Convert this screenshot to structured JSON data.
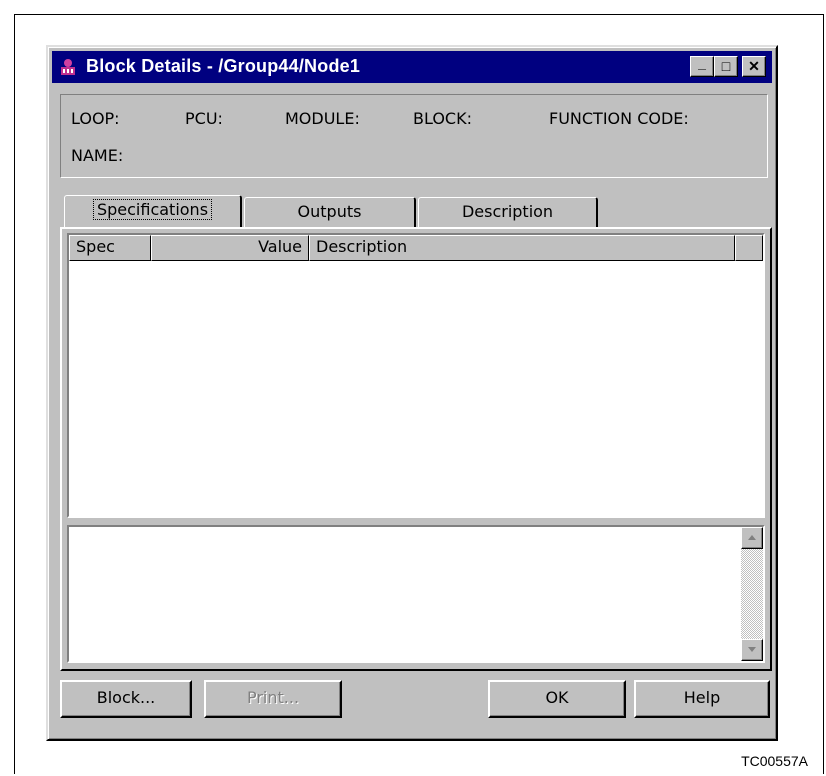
{
  "window": {
    "title": "Block Details - /Group44/Node1",
    "controls": {
      "minimize": "_",
      "maximize": "□",
      "close": "✕"
    }
  },
  "info": {
    "loop_label": "LOOP:",
    "pcu_label": "PCU:",
    "module_label": "MODULE:",
    "block_label": "BLOCK:",
    "function_code_label": "FUNCTION CODE:",
    "name_label": "NAME:"
  },
  "tabs": [
    {
      "label": "Specifications",
      "active": true
    },
    {
      "label": "Outputs",
      "active": false
    },
    {
      "label": "Description",
      "active": false
    }
  ],
  "table": {
    "columns": [
      "Spec",
      "Value",
      "Description"
    ],
    "rows": []
  },
  "buttons": {
    "block": "Block...",
    "print": "Print...",
    "ok": "OK",
    "help": "Help"
  },
  "figure_id": "TC00557A",
  "colors": {
    "titlebar": "#000080",
    "face": "#c0c0c0"
  },
  "icons": [
    "app-icon",
    "minimize-icon",
    "maximize-icon",
    "close-icon",
    "scroll-up-arrow-icon",
    "scroll-down-arrow-icon"
  ]
}
